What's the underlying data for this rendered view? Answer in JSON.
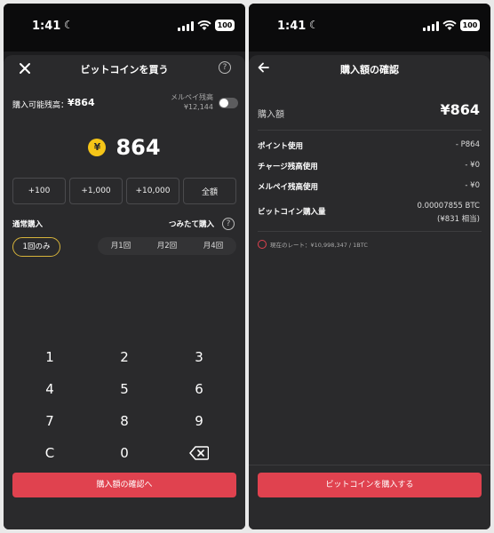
{
  "status": {
    "time": "1:41",
    "battery": "100"
  },
  "buy": {
    "title": "ビットコインを買う",
    "available_label": "購入可能残高：",
    "available_value": "¥864",
    "merpay_label": "メルペイ残高",
    "merpay_value": "¥12,144",
    "yen_symbol": "¥",
    "amount": "864",
    "quick_amounts": [
      "+100",
      "+1,000",
      "+10,000",
      "全額"
    ],
    "normal_label": "通常購入",
    "tsumitate_label": "つみたて購入",
    "once_label": "1回のみ",
    "frequency": [
      "月1回",
      "月2回",
      "月4回"
    ],
    "keys": [
      "1",
      "2",
      "3",
      "4",
      "5",
      "6",
      "7",
      "8",
      "9",
      "C",
      "0"
    ],
    "cta": "購入額の確認へ"
  },
  "confirm": {
    "title": "購入額の確認",
    "amount_label": "購入額",
    "amount_value": "¥864",
    "rows": [
      {
        "label": "ポイント使用",
        "value": "- P864"
      },
      {
        "label": "チャージ残高使用",
        "value": "- ¥0"
      },
      {
        "label": "メルペイ残高使用",
        "value": "- ¥0"
      },
      {
        "label": "ビットコイン購入量",
        "value": "0.00007855 BTC",
        "sub": "(¥831 相当)"
      }
    ],
    "rate_text": "現在のレート：¥10,998,347 / 1BTC",
    "cta": "ビットコインを購入する"
  },
  "colors": {
    "accent": "#e0424f",
    "coin": "#f5c518",
    "selected_border": "#d7b43b"
  }
}
